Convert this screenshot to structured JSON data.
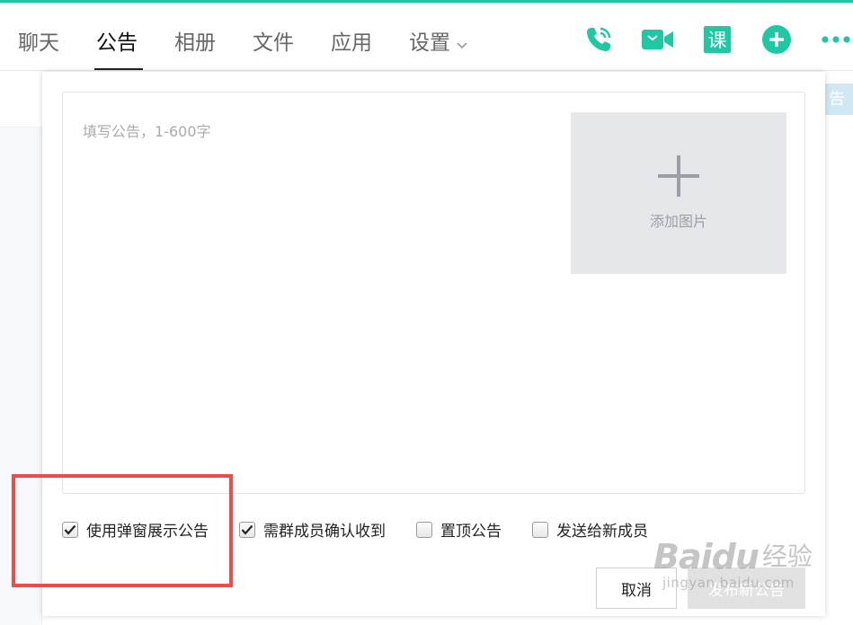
{
  "colors": {
    "accent": "#1fc8a2",
    "highlight": "#f04a4a"
  },
  "header": {
    "tabs": [
      {
        "label": "聊天"
      },
      {
        "label": "公告",
        "active": true
      },
      {
        "label": "相册"
      },
      {
        "label": "文件"
      },
      {
        "label": "应用"
      },
      {
        "label": "设置",
        "dropdown": true
      }
    ],
    "tools": [
      "phone-icon",
      "video-call-icon",
      "course-icon",
      "add-circle-icon",
      "more-icon"
    ],
    "course_glyph": "课"
  },
  "background": {
    "right_strip_text": "告"
  },
  "editor": {
    "placeholder": "填写公告，1-600字",
    "value": "",
    "add_image_label": "添加图片"
  },
  "options": [
    {
      "label": "使用弹窗展示公告",
      "checked": true
    },
    {
      "label": "需群成员确认收到",
      "checked": true
    },
    {
      "label": "置顶公告",
      "checked": false
    },
    {
      "label": "发送给新成员",
      "checked": false
    }
  ],
  "buttons": {
    "cancel": "取消",
    "publish": "发布新公告"
  },
  "watermark": {
    "brand": "Baidu",
    "brand_cn": "经验",
    "url": "jingyan.baidu.com"
  }
}
